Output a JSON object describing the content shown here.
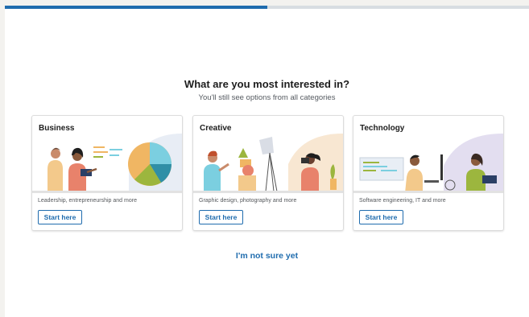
{
  "progress": {
    "fraction": 0.5
  },
  "header": {
    "title": "What are you most interested in?",
    "subtitle": "You'll still see options from all categories"
  },
  "cards": [
    {
      "title": "Business",
      "description": "Leadership, entrepreneurship and more",
      "button": "Start here"
    },
    {
      "title": "Creative",
      "description": "Graphic design, photography and more",
      "button": "Start here"
    },
    {
      "title": "Technology",
      "description": "Software engineering, IT and more",
      "button": "Start here"
    }
  ],
  "footer": {
    "not_sure_label": "I'm not sure yet"
  },
  "colors": {
    "accent": "#1f6cae",
    "track": "#d8dde2"
  }
}
